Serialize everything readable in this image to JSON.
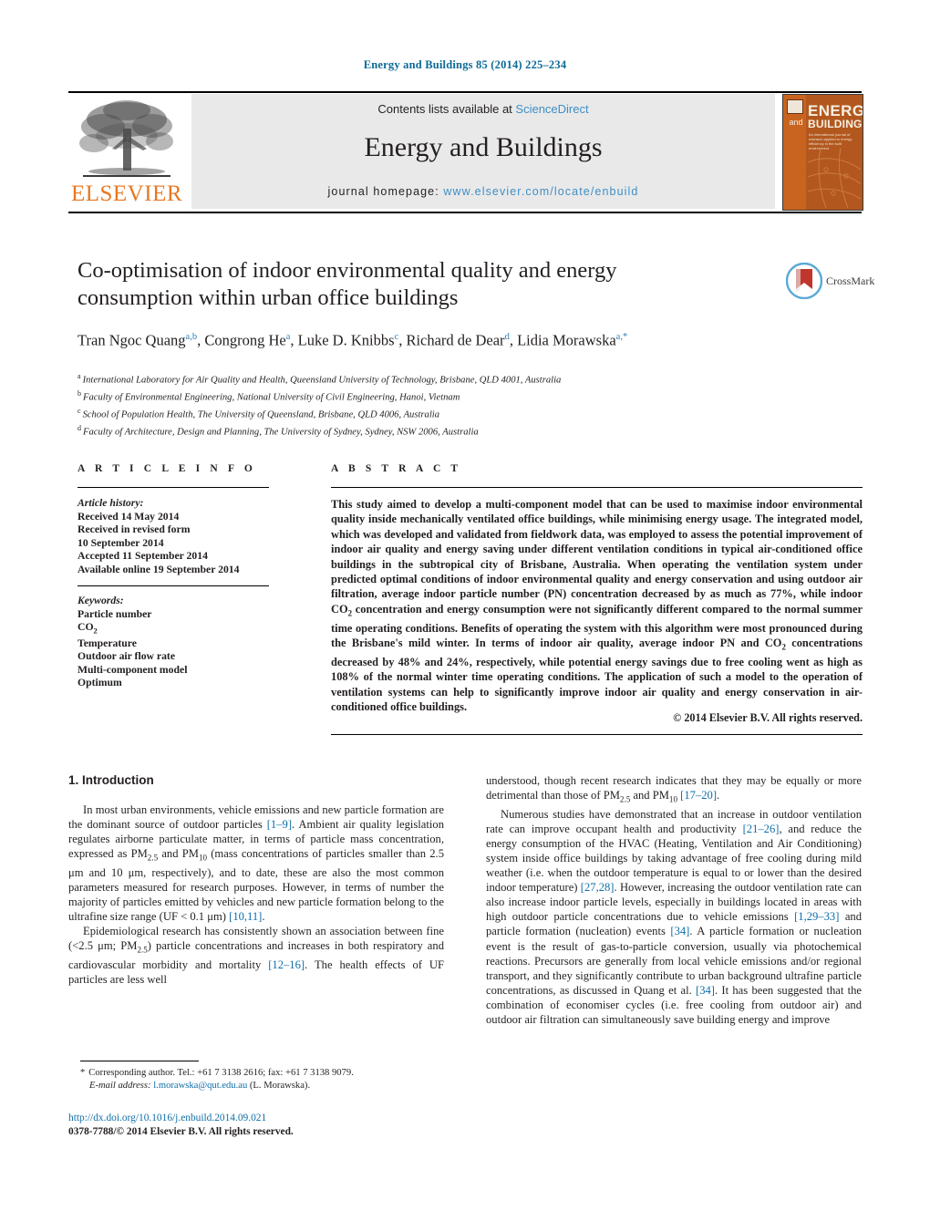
{
  "running_head": "Energy and Buildings 85 (2014) 225–234",
  "journal_header": {
    "publisher_name": "ELSEVIER",
    "contents_prefix": "Contents lists available at ",
    "contents_link": "ScienceDirect",
    "journal_title": "Energy and Buildings",
    "homepage_prefix": "journal homepage: ",
    "homepage_url": "www.elsevier.com/locate/enbuild",
    "cover": {
      "and": "and",
      "energy": "ENERGY",
      "buildings": "BUILDINGS",
      "subtitle": "An international journal of research applied to energy efficiency in the built environment"
    }
  },
  "article": {
    "title": "Co-optimisation of indoor environmental quality and energy consumption within urban office buildings",
    "authors_line_1": "Tran Ngoc Quang",
    "authors_line_1_sup": "a,b",
    "crossmark_label": "CrossMark",
    "authors_html": "Tran Ngoc Quang<sup>a,b</sup>, Congrong He<sup>a</sup>, Luke D. Knibbs<sup>c</sup>, Richard de Dear<sup>d</sup>, Lidia Morawska<sup>a,*</sup>",
    "affiliations": [
      {
        "mark": "a",
        "text": "International Laboratory for Air Quality and Health, Queensland University of Technology, Brisbane, QLD 4001, Australia"
      },
      {
        "mark": "b",
        "text": "Faculty of Environmental Engineering, National University of Civil Engineering, Hanoi, Vietnam"
      },
      {
        "mark": "c",
        "text": "School of Population Health, The University of Queensland, Brisbane, QLD 4006, Australia"
      },
      {
        "mark": "d",
        "text": "Faculty of Architecture, Design and Planning, The University of Sydney, Sydney, NSW 2006, Australia"
      }
    ]
  },
  "article_info": {
    "heading": "A R T I C L E    I N F O",
    "history_label": "Article history:",
    "history_lines": [
      "Received 14 May 2014",
      "Received in revised form",
      "10 September 2014",
      "Accepted 11 September 2014",
      "Available online 19 September 2014"
    ],
    "keywords_label": "Keywords:",
    "keywords_html": "Particle number<br>CO<sub>2</sub><br>Temperature<br>Outdoor air flow rate<br>Multi-component model<br>Optimum",
    "keywords": [
      "Particle number",
      "CO2",
      "Temperature",
      "Outdoor air flow rate",
      "Multi-component model",
      "Optimum"
    ]
  },
  "abstract": {
    "heading": "A B S T R A C T",
    "text_html": "This study aimed to develop a multi-component model that can be used to maximise indoor environmental quality inside mechanically ventilated office buildings, while minimising energy usage. The integrated model, which was developed and validated from fieldwork data, was employed to assess the potential improvement of indoor air quality and energy saving under different ventilation conditions in typical air-conditioned office buildings in the subtropical city of Brisbane, Australia. When operating the ventilation system under predicted optimal conditions of indoor environmental quality and energy conservation and using outdoor air filtration, average indoor particle number (PN) concentration decreased by as much as 77%, while indoor CO<sub>2</sub> concentration and energy consumption were not significantly different compared to the normal summer time operating conditions. Benefits of operating the system with this algorithm were most pronounced during the Brisbane's mild winter. In terms of indoor air quality, average indoor PN and CO<sub>2</sub> concentrations decreased by 48% and 24%, respectively, while potential energy savings due to free cooling went as high as 108% of the normal winter time operating conditions. The application of such a model to the operation of ventilation systems can help to significantly improve indoor air quality and energy conservation in air-conditioned office buildings.",
    "copyright": "© 2014 Elsevier B.V. All rights reserved."
  },
  "body": {
    "section_number_title": "1.  Introduction",
    "left_column_html": "<p>In most urban environments, vehicle emissions and new particle formation are the dominant source of outdoor particles <span class=\"ref\">[1–9]</span>. Ambient air quality legislation regulates airborne particulate matter, in terms of particle mass concentration, expressed as PM<sub>2.5</sub> and PM<sub>10</sub> (mass concentrations of particles smaller than 2.5 &mu;m and 10 &mu;m, respectively), and to date, these are also the most common parameters measured for research purposes. However, in terms of number the majority of particles emitted by vehicles and new particle formation belong to the ultrafine size range (UF &lt; 0.1 &mu;m) <span class=\"ref\">[10,11]</span>.</p><p>Epidemiological research has consistently shown an association between fine (&lt;2.5 &mu;m; PM<sub>2.5</sub>) particle concentrations and increases in both respiratory and cardiovascular morbidity and mortality <span class=\"ref\">[12–16]</span>. The health effects of UF particles are less well</p>",
    "right_column_html": "<p style=\"text-indent:0\">understood, though recent research indicates that they may be equally or more detrimental than those of PM<sub>2.5</sub> and PM<sub>10</sub> <span class=\"ref\">[17–20]</span>.</p><p>Numerous studies have demonstrated that an increase in outdoor ventilation rate can improve occupant health and productivity <span class=\"ref\">[21–26]</span>, and reduce the energy consumption of the HVAC (Heating, Ventilation and Air Conditioning) system inside office buildings by taking advantage of free cooling during mild weather (i.e. when the outdoor temperature is equal to or lower than the desired indoor temperature) <span class=\"ref\">[27,28]</span>. However, increasing the outdoor ventilation rate can also increase indoor particle levels, especially in buildings located in areas with high outdoor particle concentrations due to vehicle emissions <span class=\"ref\">[1,29–33]</span> and particle formation (nucleation) events <span class=\"ref\">[34]</span>. A particle formation or nucleation event is the result of gas-to-particle conversion, usually via photochemical reactions. Precursors are generally from local vehicle emissions and/or regional transport, and they significantly contribute to urban background ultrafine particle concentrations, as discussed in Quang et al. <span class=\"ref\">[34]</span>. It has been suggested that the combination of economiser cycles (i.e. free cooling from outdoor air) and outdoor air filtration can simultaneously save building energy and improve</p>"
  },
  "footnote": {
    "star": "*",
    "corresponding": "Corresponding author. Tel.: +61 7 3138 2616; fax: +61 7 3138 9079.",
    "email_label": "E-mail address:",
    "email": "l.morawska@qut.edu.au",
    "email_suffix": "(L. Morawska)."
  },
  "doi_block": {
    "doi_url": "http://dx.doi.org/10.1016/j.enbuild.2014.09.021",
    "issn_line": "0378-7788/© 2014 Elsevier B.V. All rights reserved."
  },
  "colors": {
    "link_blue": "#0e6ea8",
    "sciencedirect_blue": "#3f8fc5",
    "elsevier_orange": "#e87722",
    "cover_orange": "#b2581f"
  }
}
